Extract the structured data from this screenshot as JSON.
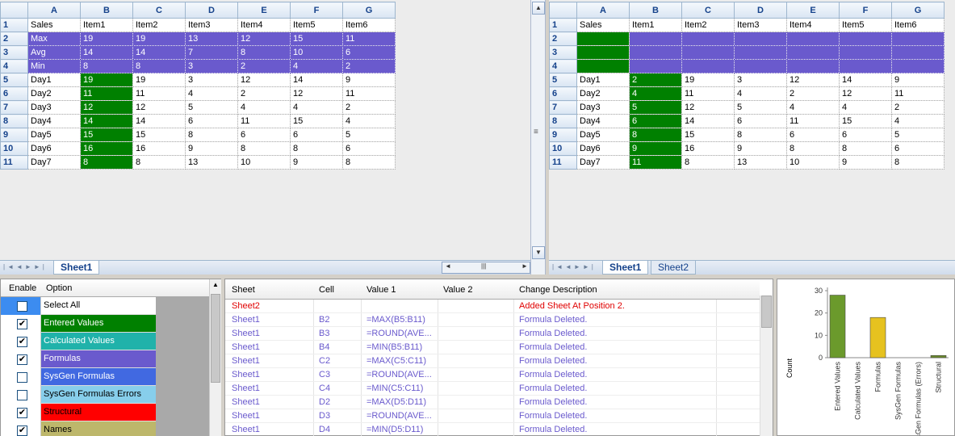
{
  "left_sheet": {
    "columns": [
      "A",
      "B",
      "C",
      "D",
      "E",
      "F",
      "G"
    ],
    "rows": [
      {
        "n": "1",
        "cells": [
          "Sales",
          "Item1",
          "Item2",
          "Item3",
          "Item4",
          "Item5",
          "Item6"
        ]
      },
      {
        "n": "2",
        "cells": [
          "Max",
          "19",
          "19",
          "13",
          "12",
          "15",
          "11"
        ]
      },
      {
        "n": "3",
        "cells": [
          "Avg",
          "14",
          "14",
          "7",
          "8",
          "10",
          "6"
        ]
      },
      {
        "n": "4",
        "cells": [
          "Min",
          "8",
          "8",
          "3",
          "2",
          "4",
          "2"
        ]
      },
      {
        "n": "5",
        "cells": [
          "Day1",
          "19",
          "19",
          "3",
          "12",
          "14",
          "9"
        ]
      },
      {
        "n": "6",
        "cells": [
          "Day2",
          "11",
          "11",
          "4",
          "2",
          "12",
          "11"
        ]
      },
      {
        "n": "7",
        "cells": [
          "Day3",
          "12",
          "12",
          "5",
          "4",
          "4",
          "2"
        ]
      },
      {
        "n": "8",
        "cells": [
          "Day4",
          "14",
          "14",
          "6",
          "11",
          "15",
          "4"
        ]
      },
      {
        "n": "9",
        "cells": [
          "Day5",
          "15",
          "15",
          "8",
          "6",
          "6",
          "5"
        ]
      },
      {
        "n": "10",
        "cells": [
          "Day6",
          "16",
          "16",
          "9",
          "8",
          "8",
          "6"
        ]
      },
      {
        "n": "11",
        "cells": [
          "Day7",
          "8",
          "8",
          "13",
          "10",
          "9",
          "8"
        ]
      }
    ],
    "tabs": [
      "Sheet1"
    ]
  },
  "right_sheet": {
    "columns": [
      "A",
      "B",
      "C",
      "D",
      "E",
      "F",
      "G"
    ],
    "rows": [
      {
        "n": "1",
        "cells": [
          "Sales",
          "Item1",
          "Item2",
          "Item3",
          "Item4",
          "Item5",
          "Item6"
        ]
      },
      {
        "n": "2",
        "cells": [
          "",
          "",
          "",
          "",
          "",
          "",
          ""
        ]
      },
      {
        "n": "3",
        "cells": [
          "",
          "",
          "",
          "",
          "",
          "",
          ""
        ]
      },
      {
        "n": "4",
        "cells": [
          "",
          "",
          "",
          "",
          "",
          "",
          ""
        ]
      },
      {
        "n": "5",
        "cells": [
          "Day1",
          "2",
          "19",
          "3",
          "12",
          "14",
          "9"
        ]
      },
      {
        "n": "6",
        "cells": [
          "Day2",
          "4",
          "11",
          "4",
          "2",
          "12",
          "11"
        ]
      },
      {
        "n": "7",
        "cells": [
          "Day3",
          "5",
          "12",
          "5",
          "4",
          "4",
          "2"
        ]
      },
      {
        "n": "8",
        "cells": [
          "Day4",
          "6",
          "14",
          "6",
          "11",
          "15",
          "4"
        ]
      },
      {
        "n": "9",
        "cells": [
          "Day5",
          "8",
          "15",
          "8",
          "6",
          "6",
          "5"
        ]
      },
      {
        "n": "10",
        "cells": [
          "Day6",
          "9",
          "16",
          "9",
          "8",
          "8",
          "6"
        ]
      },
      {
        "n": "11",
        "cells": [
          "Day7",
          "11",
          "8",
          "13",
          "10",
          "9",
          "8"
        ]
      }
    ],
    "tabs": [
      "Sheet1",
      "Sheet2"
    ]
  },
  "options": {
    "header_enable": "Enable",
    "header_option": "Option",
    "items": [
      {
        "label": "Select All",
        "checked": false,
        "color": "#ffffff",
        "text_color": "#000000",
        "box_color": "#3c8cf0"
      },
      {
        "label": "Entered Values",
        "checked": true,
        "color": "#008000",
        "text_color": "#ffffff",
        "box_color": "#ffffff"
      },
      {
        "label": "Calculated Values",
        "checked": true,
        "color": "#20b2aa",
        "text_color": "#ffffff",
        "box_color": "#ffffff"
      },
      {
        "label": "Formulas",
        "checked": true,
        "color": "#6a5acd",
        "text_color": "#ffffff",
        "box_color": "#ffffff"
      },
      {
        "label": "SysGen Formulas",
        "checked": false,
        "color": "#4169e1",
        "text_color": "#ffffff",
        "box_color": "#ffffff"
      },
      {
        "label": "SysGen Formulas Errors",
        "checked": false,
        "color": "#87ceeb",
        "text_color": "#000000",
        "box_color": "#ffffff"
      },
      {
        "label": "Structural",
        "checked": true,
        "color": "#ff0000",
        "text_color": "#000000",
        "box_color": "#ffffff"
      },
      {
        "label": "Names",
        "checked": true,
        "color": "#bdb76b",
        "text_color": "#000000",
        "box_color": "#ffffff"
      }
    ],
    "check_glyph": "✔"
  },
  "changelog": {
    "headers": {
      "sheet": "Sheet",
      "cell": "Cell",
      "value1": "Value 1",
      "value2": "Value 2",
      "desc": "Change Description"
    },
    "rows": [
      {
        "style": "red",
        "sheet": "Sheet2",
        "cell": "",
        "value1": "",
        "value2": "",
        "desc": "Added Sheet At Position 2."
      },
      {
        "style": "blue",
        "sheet": "Sheet1",
        "cell": "B2",
        "value1": "=MAX(B5:B11)",
        "value2": "",
        "desc": "Formula Deleted."
      },
      {
        "style": "blue",
        "sheet": "Sheet1",
        "cell": "B3",
        "value1": "=ROUND(AVE...",
        "value2": "",
        "desc": "Formula Deleted."
      },
      {
        "style": "blue",
        "sheet": "Sheet1",
        "cell": "B4",
        "value1": "=MIN(B5:B11)",
        "value2": "",
        "desc": "Formula Deleted."
      },
      {
        "style": "blue",
        "sheet": "Sheet1",
        "cell": "C2",
        "value1": "=MAX(C5:C11)",
        "value2": "",
        "desc": "Formula Deleted."
      },
      {
        "style": "blue",
        "sheet": "Sheet1",
        "cell": "C3",
        "value1": "=ROUND(AVE...",
        "value2": "",
        "desc": "Formula Deleted."
      },
      {
        "style": "blue",
        "sheet": "Sheet1",
        "cell": "C4",
        "value1": "=MIN(C5:C11)",
        "value2": "",
        "desc": "Formula Deleted."
      },
      {
        "style": "blue",
        "sheet": "Sheet1",
        "cell": "D2",
        "value1": "=MAX(D5:D11)",
        "value2": "",
        "desc": "Formula Deleted."
      },
      {
        "style": "blue",
        "sheet": "Sheet1",
        "cell": "D3",
        "value1": "=ROUND(AVE...",
        "value2": "",
        "desc": "Formula Deleted."
      },
      {
        "style": "blue",
        "sheet": "Sheet1",
        "cell": "D4",
        "value1": "=MIN(D5:D11)",
        "value2": "",
        "desc": "Formula Deleted."
      }
    ]
  },
  "chart_data": {
    "type": "bar",
    "ylabel": "Count",
    "ylim": [
      0,
      30
    ],
    "yticks": [
      "0",
      "10",
      "20",
      "30"
    ],
    "categories": [
      "Entered Values",
      "Calculated Values",
      "Formulas",
      "SysGen Formulas",
      "SysGen Formulas (Errors)",
      "Structural"
    ],
    "values": [
      28,
      0,
      18,
      0,
      0,
      1
    ],
    "colors": [
      "#6b9a2c",
      "#20b2aa",
      "#e6c21f",
      "#4169e1",
      "#87ceeb",
      "#6b8a2c"
    ],
    "grid": false,
    "legend": "none"
  }
}
